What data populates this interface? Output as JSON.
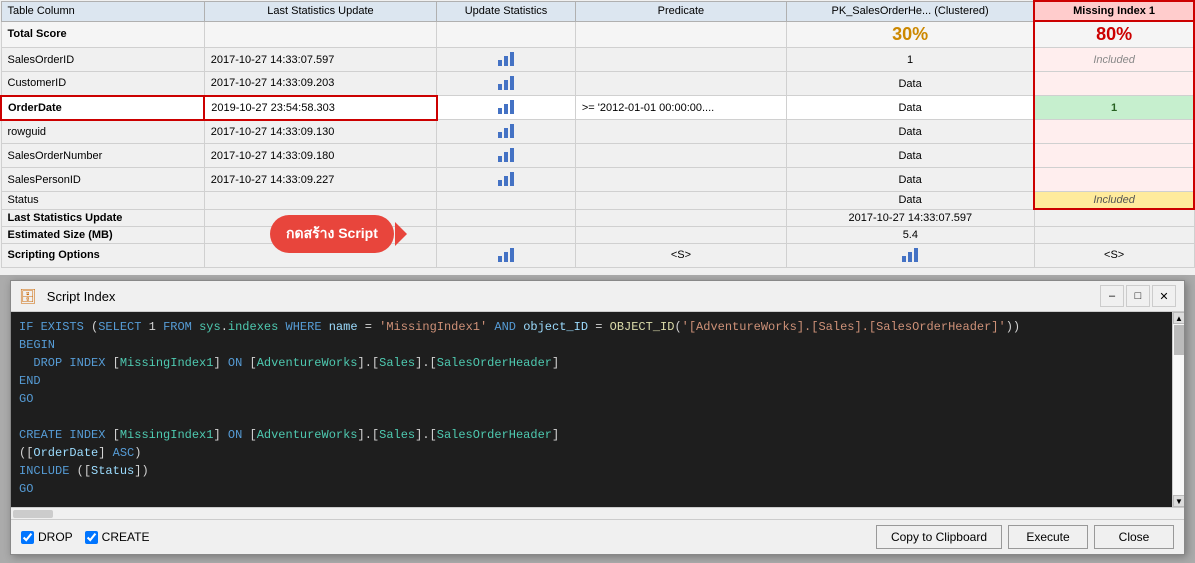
{
  "topPanel": {
    "columns": {
      "tableColumn": "Table Column",
      "lastStats": "Last Statistics Update",
      "updateStats": "Update Statistics",
      "predicate": "Predicate",
      "pkClustered": "PK_SalesOrderHe... (Clustered)",
      "missingIndex1": "Missing Index 1"
    },
    "totalScore": {
      "label": "Total Score",
      "pkScore": "30%",
      "missingScore": "80%"
    },
    "rows": [
      {
        "col": "SalesOrderID",
        "lastStats": "2017-10-27 14:33:07.597",
        "hasBar": true,
        "predicate": "",
        "pk": "1",
        "missing": "Included",
        "missingClass": "cell-included"
      },
      {
        "col": "CustomerID",
        "lastStats": "2017-10-27 14:33:09.203",
        "hasBar": true,
        "predicate": "",
        "pk": "Data",
        "pkClass": "text-center",
        "missing": "",
        "missingClass": ""
      },
      {
        "col": "OrderDate",
        "lastStats": "2019-10-27 23:54:58.303",
        "hasBar": true,
        "predicate": ">= '2012-01-01 00:00:00....",
        "pk": "Data",
        "pkClass": "text-center",
        "missing": "1",
        "missingClass": "cell-green",
        "highlighted": true
      },
      {
        "col": "rowguid",
        "lastStats": "2017-10-27 14:33:09.130",
        "hasBar": true,
        "predicate": "",
        "pk": "Data",
        "pkClass": "text-center",
        "missing": "",
        "missingClass": ""
      },
      {
        "col": "SalesOrderNumber",
        "lastStats": "2017-10-27 14:33:09.180",
        "hasBar": true,
        "predicate": "",
        "pk": "Data",
        "pkClass": "text-center",
        "missing": "",
        "missingClass": ""
      },
      {
        "col": "SalesPersonID",
        "lastStats": "2017-10-27 14:33:09.227",
        "hasBar": true,
        "predicate": "",
        "pk": "Data",
        "pkClass": "text-center",
        "missing": "",
        "missingClass": ""
      },
      {
        "col": "Status",
        "lastStats": "",
        "hasBar": false,
        "predicate": "",
        "pk": "Data",
        "pkClass": "text-center",
        "missing": "Included",
        "missingClass": "cell-included cell-yellow"
      }
    ],
    "footerRows": [
      {
        "label": "Last Statistics Update",
        "value": "2017-10-27 14:33:07.597"
      },
      {
        "label": "Estimated Size (MB)",
        "value": "5.4"
      }
    ],
    "scriptingOptions": "Scripting Options"
  },
  "callout": {
    "text": "กดสร้าง Script"
  },
  "scriptWindow": {
    "title": "Script Index",
    "icon": "📋",
    "lines": [
      "IF EXISTS (SELECT 1 FROM sys.indexes WHERE name = 'MissingIndex1' AND object_ID = OBJECT_ID('[AdventureWorks].[Sales].[SalesOrderHeader]'))",
      "BEGIN",
      "  DROP INDEX [MissingIndex1] ON [AdventureWorks].[Sales].[SalesOrderHeader]",
      "END",
      "GO",
      "",
      "CREATE INDEX [MissingIndex1] ON [AdventureWorks].[Sales].[SalesOrderHeader]",
      "([OrderDate] ASC)",
      "INCLUDE ([Status])",
      "GO"
    ],
    "checkboxes": {
      "drop": {
        "label": "DROP",
        "checked": true
      },
      "create": {
        "label": "CREATE",
        "checked": true
      }
    },
    "buttons": {
      "copyClipboard": "Copy to Clipboard",
      "execute": "Execute",
      "close": "Close"
    }
  }
}
